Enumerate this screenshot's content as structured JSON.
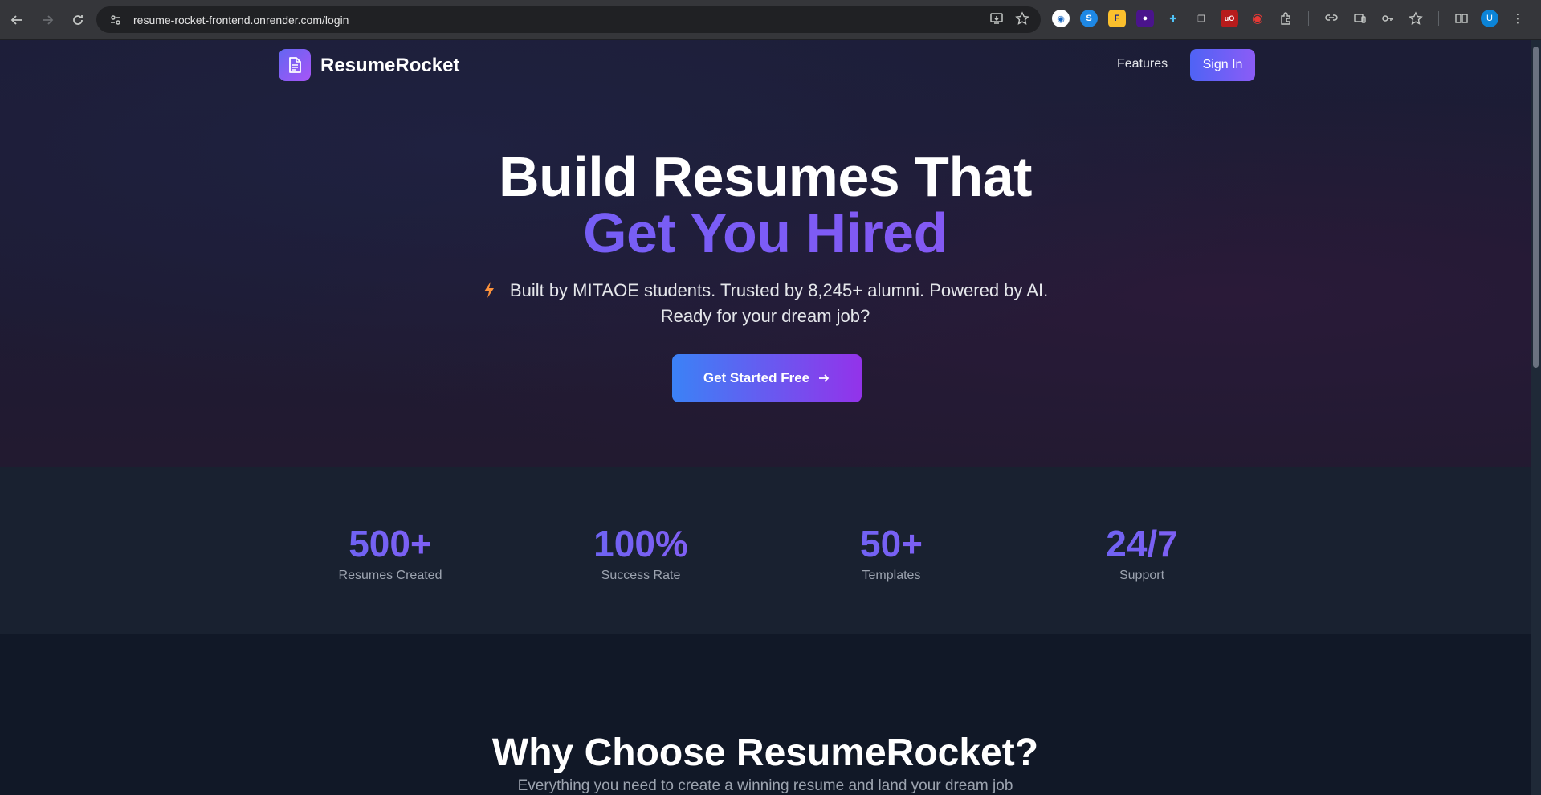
{
  "browser": {
    "url": "resume-rocket-frontend.onrender.com/login",
    "profile_initial": "U",
    "extensions": [
      {
        "name": "extension-1",
        "letter": "",
        "color": "#ffffff"
      },
      {
        "name": "extension-2",
        "letter": "S",
        "color": "#1e88e5"
      },
      {
        "name": "extension-3",
        "letter": "F",
        "color": "#fbc02d"
      },
      {
        "name": "extension-4",
        "letter": "",
        "color": "#6a1b9a"
      },
      {
        "name": "extension-5",
        "letter": "",
        "color": "#1e88e5"
      },
      {
        "name": "extension-6",
        "letter": "",
        "color": "#9e9e9e"
      },
      {
        "name": "extension-7",
        "letter": "uO",
        "color": "#b71c1c"
      },
      {
        "name": "extension-8",
        "letter": "",
        "color": "#c62828"
      }
    ]
  },
  "nav": {
    "brand": "ResumeRocket",
    "features": "Features",
    "signin": "Sign In"
  },
  "hero": {
    "title_line1": "Build Resumes That",
    "title_line2": "Get You Hired",
    "tagline_line1": "Built by MITAOE students. Trusted by 8,245+ alumni. Powered by AI.",
    "tagline_line2": "Ready for your dream job?",
    "cta": "Get Started Free"
  },
  "stats": [
    {
      "value": "500+",
      "label": "Resumes Created"
    },
    {
      "value": "100%",
      "label": "Success Rate"
    },
    {
      "value": "50+",
      "label": "Templates"
    },
    {
      "value": "24/7",
      "label": "Support"
    }
  ],
  "why": {
    "title": "Why Choose ResumeRocket?",
    "subtitle": "Everything you need to create a winning resume and land your dream job"
  },
  "colors": {
    "accent_start": "#6366f1",
    "accent_end": "#9333ea",
    "bolt": "#fb923c"
  }
}
